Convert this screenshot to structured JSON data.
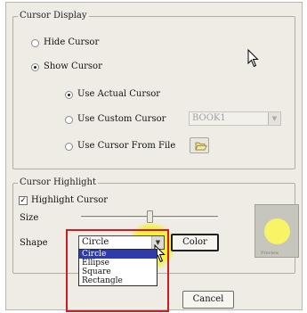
{
  "cursor_display": {
    "legend": "Cursor Display",
    "hide_cursor": "Hide Cursor",
    "show_cursor": "Show Cursor",
    "use_actual_cursor": "Use Actual Cursor",
    "use_custom_cursor": "Use Custom Cursor",
    "custom_cursor_value": "BOOK1",
    "use_cursor_from_file": "Use Cursor From File",
    "selected": "show_cursor",
    "cursor_mode": "use_actual_cursor"
  },
  "cursor_highlight": {
    "legend": "Cursor Highlight",
    "highlight_cursor": "Highlight Cursor",
    "highlight_checked": true,
    "size_label": "Size",
    "size_level": 0.5,
    "shape_label": "Shape",
    "shape_value": "Circle",
    "shape_options": [
      "Circle",
      "Ellipse",
      "Square",
      "Rectangle"
    ],
    "selected_option_index": 0,
    "color_button": "Color",
    "preview_caption": "Preview",
    "preview_color": "#f7f466",
    "annotation_color": "#d11a22"
  },
  "footer": {
    "cancel_button": "Cancel"
  }
}
